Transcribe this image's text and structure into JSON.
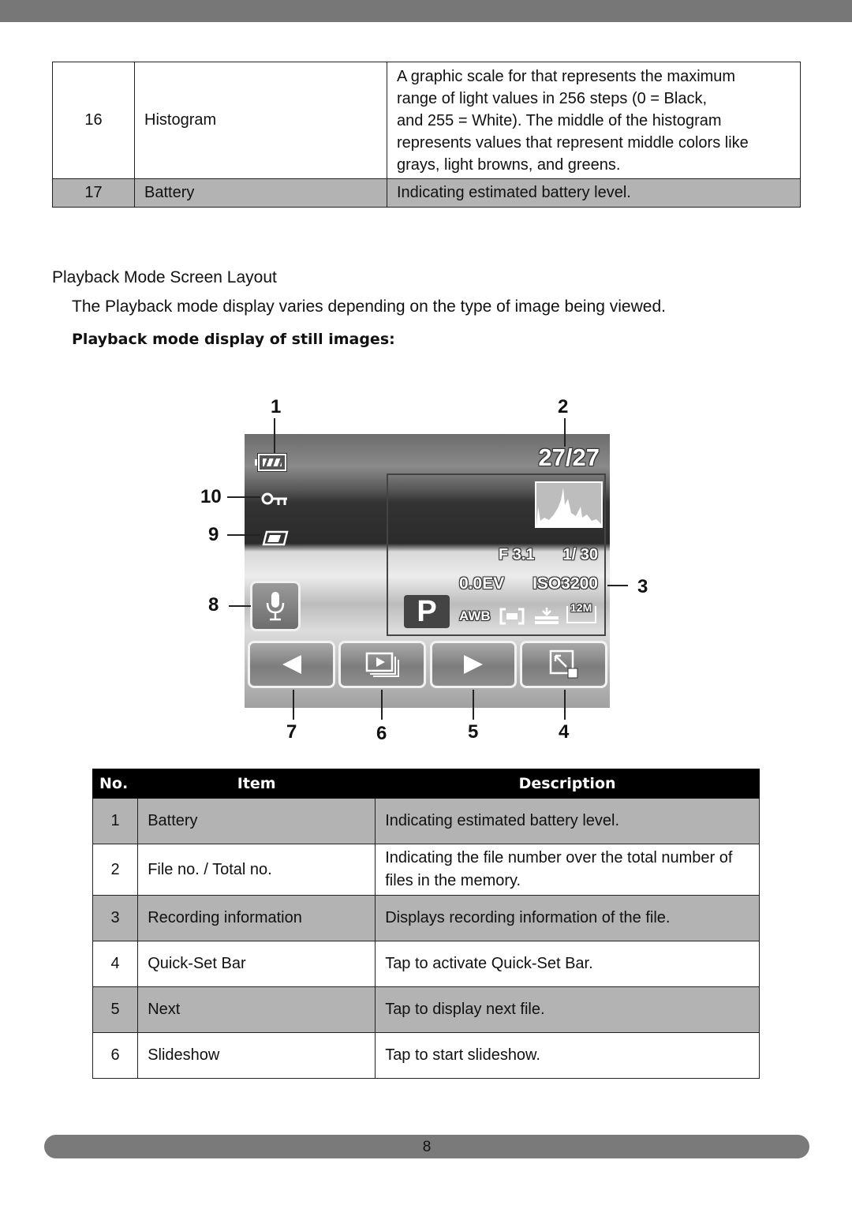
{
  "table_top": {
    "rows": [
      {
        "no": "16",
        "item": "Histogram",
        "description_lines": [
          "A graphic scale for that represents the maximum",
          "range of light values in 256 steps (0 = Black,",
          "and 255 = White).  The middle of the histogram",
          "represents values that represent middle colors like",
          "grays, light browns, and greens."
        ]
      },
      {
        "no": "17",
        "item": "Battery",
        "description": "Indicating estimated battery level."
      }
    ]
  },
  "section": {
    "title": "Playback Mode Screen Layout",
    "intro": "The Playback mode display varies depending on the type of image being viewed.",
    "subheading": "Playback mode display of still images:"
  },
  "figure": {
    "callouts": {
      "c1": "1",
      "c2": "2",
      "c3": "3",
      "c4": "4",
      "c5": "5",
      "c6": "6",
      "c7": "7",
      "c8": "8",
      "c9": "9",
      "c10": "10"
    },
    "screen": {
      "file_counter": "27/27",
      "aperture": "F 3.1",
      "shutter": "1/ 30",
      "ev": "0.0EV",
      "iso": "ISO3200",
      "mode": "P",
      "white_balance": "AWB",
      "resolution": "12M",
      "icons": [
        "battery-icon",
        "protect-key-icon",
        "dpof-print-icon",
        "voice-memo-mic-icon",
        "previous-icon",
        "slideshow-icon",
        "next-icon",
        "quick-set-icon",
        "metering-icon",
        "quality-icon",
        "histogram"
      ]
    }
  },
  "table_main": {
    "headers": {
      "no": "No.",
      "item": "Item",
      "description": "Description"
    },
    "rows": [
      {
        "no": "1",
        "item": "Battery",
        "description": "Indicating estimated battery level."
      },
      {
        "no": "2",
        "item": "File no. / Total no.",
        "description": "Indicating the file number over the total number of files in the memory."
      },
      {
        "no": "3",
        "item": "Recording information",
        "description": "Displays recording information of the file."
      },
      {
        "no": "4",
        "item": "Quick-Set Bar",
        "description": "Tap to activate Quick-Set Bar."
      },
      {
        "no": "5",
        "item": "Next",
        "description": "Tap to display next file."
      },
      {
        "no": "6",
        "item": "Slideshow",
        "description": "Tap to start slideshow."
      }
    ]
  },
  "footer": {
    "page_number": "8"
  },
  "colors": {
    "header_bar": "#777777",
    "row_shade": "#b3b3b3",
    "table_header": "#000000"
  }
}
